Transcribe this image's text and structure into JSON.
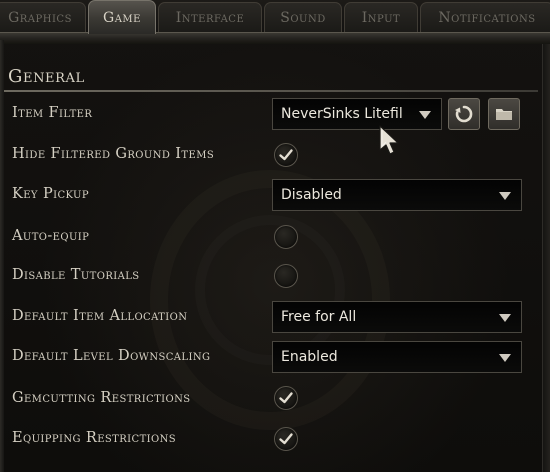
{
  "tabs": [
    {
      "label": "Graphics",
      "active": false
    },
    {
      "label": "Game",
      "active": true
    },
    {
      "label": "Interface",
      "active": false
    },
    {
      "label": "Sound",
      "active": false
    },
    {
      "label": "Input",
      "active": false
    },
    {
      "label": "Notifications",
      "active": false
    }
  ],
  "section": {
    "title": "General"
  },
  "settings": {
    "item_filter": {
      "label": "Item Filter",
      "value": "NeverSinks Litefil",
      "reload_icon": "reload-icon",
      "folder_icon": "folder-icon"
    },
    "hide_filtered_ground_items": {
      "label": "Hide Filtered Ground Items",
      "checked": true
    },
    "key_pickup": {
      "label": "Key Pickup",
      "value": "Disabled"
    },
    "auto_equip": {
      "label": "Auto-equip",
      "checked": false
    },
    "disable_tutorials": {
      "label": "Disable Tutorials",
      "checked": false
    },
    "default_item_allocation": {
      "label": "Default Item Allocation",
      "value": "Free for All"
    },
    "default_level_downscaling": {
      "label": "Default Level Downscaling",
      "value": "Enabled"
    },
    "gemcutting_restrictions": {
      "label": "Gemcutting Restrictions",
      "checked": true
    },
    "equipping_restrictions": {
      "label": "Equipping Restrictions",
      "checked": true
    }
  },
  "colors": {
    "text": "#d6d1c4",
    "check": "#d8d3c6",
    "background": "#0e0d0b"
  }
}
